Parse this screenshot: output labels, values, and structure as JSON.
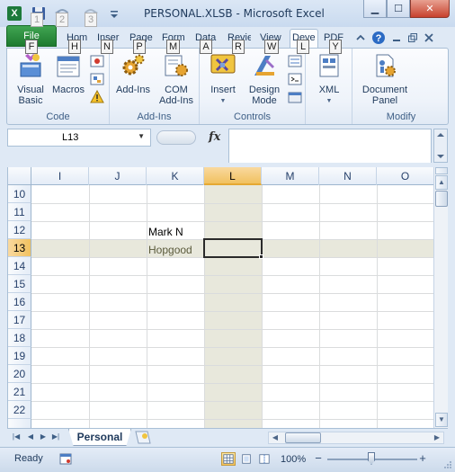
{
  "window": {
    "title": "PERSONAL.XLSB - Microsoft Excel",
    "app_icon": "X",
    "minimize": "▁",
    "maximize": "☐",
    "close": "✕"
  },
  "qat_keytips": [
    "1",
    "2",
    "3"
  ],
  "tabs": [
    {
      "label": "File",
      "keytip": "F"
    },
    {
      "label": "Hom",
      "keytip": "H"
    },
    {
      "label": "Inser",
      "keytip": "N"
    },
    {
      "label": "Page",
      "keytip": "P"
    },
    {
      "label": "Form",
      "keytip": "M"
    },
    {
      "label": "Data",
      "keytip": "A"
    },
    {
      "label": "Revie",
      "keytip": "R"
    },
    {
      "label": "View",
      "keytip": "W"
    },
    {
      "label": "Deve",
      "keytip": "L"
    },
    {
      "label": "PDF",
      "keytip": "Y"
    }
  ],
  "ribbon": {
    "groups": {
      "code": "Code",
      "addins": "Add-Ins",
      "controls": "Controls",
      "xml": "",
      "modify": "Modify"
    },
    "buttons": {
      "visual_basic": "Visual Basic",
      "macros": "Macros",
      "addins": "Add-Ins",
      "com_addins": "COM Add-Ins",
      "insert": "Insert",
      "design_mode": "Design Mode",
      "xml": "XML",
      "document_panel": "Document Panel"
    },
    "button_lines": {
      "visual_basic": [
        "Visual",
        "Basic"
      ],
      "com_addins": [
        "COM",
        "Add-Ins"
      ],
      "design_mode": [
        "Design",
        "Mode"
      ],
      "document_panel": [
        "Document",
        "Panel"
      ]
    }
  },
  "formula_bar": {
    "name_box": "L13",
    "fx": "fx",
    "formula": ""
  },
  "grid": {
    "columns": [
      "I",
      "J",
      "K",
      "L",
      "M",
      "N",
      "O"
    ],
    "selected_column": "L",
    "rows": [
      "10",
      "11",
      "12",
      "13",
      "14",
      "15",
      "16",
      "17",
      "18",
      "19",
      "20",
      "21",
      "22"
    ],
    "selected_row": "13",
    "cells": [
      {
        "ref": "K12",
        "value": "Mark N"
      },
      {
        "ref": "K13",
        "value": "Hopgood"
      }
    ],
    "active_cell": "L13"
  },
  "sheet_tabs": {
    "tabs": [
      "Personal"
    ],
    "active": "Personal"
  },
  "status": {
    "ready": "Ready",
    "zoom": "100%",
    "zoom_minus": "−",
    "zoom_plus": "+"
  },
  "colors": {
    "file_tab": "#1e7a2f",
    "selection_shade": "#e8e8dc",
    "header_selected": "#f1c15f"
  }
}
